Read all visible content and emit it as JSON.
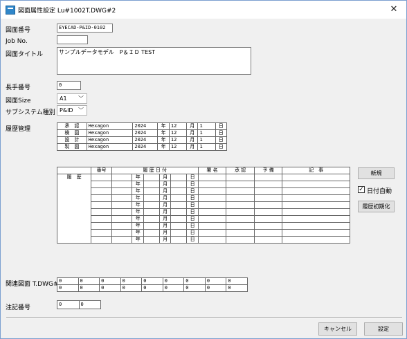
{
  "window": {
    "title": "図面属性設定 Lu#1002T.DWG#2",
    "close_icon": "close-icon"
  },
  "fields": {
    "drawing_number": {
      "label": "図面番号",
      "value": "EYECAD-P&ID-0102"
    },
    "job_no": {
      "label": "Job No.",
      "value": ""
    },
    "drawing_title": {
      "label": "図面タイトル",
      "value": "サンプルデータモデル　P＆ＩＤ TEST"
    },
    "long_number": {
      "label": "長手番号",
      "value": "0"
    },
    "drawing_size": {
      "label": "図面Size",
      "value": "A1"
    },
    "subsystem": {
      "label": "サブシステム種別",
      "value": "P&ID"
    }
  },
  "history": {
    "label": "履歴管理",
    "approvals": [
      {
        "role": "承　認",
        "name": "Hexagon",
        "year": "2024",
        "y": "年",
        "month": "12",
        "m": "月",
        "day": "1",
        "d": "日"
      },
      {
        "role": "検　図",
        "name": "Hexagon",
        "year": "2024",
        "y": "年",
        "month": "12",
        "m": "月",
        "day": "1",
        "d": "日"
      },
      {
        "role": "設　計",
        "name": "Hexagon",
        "year": "2024",
        "y": "年",
        "month": "12",
        "m": "月",
        "day": "1",
        "d": "日"
      },
      {
        "role": "製　図",
        "name": "Hexagon",
        "year": "2024",
        "y": "年",
        "month": "12",
        "m": "月",
        "day": "1",
        "d": "日"
      }
    ],
    "columns": {
      "number": "番号",
      "date": "履 歴 日 付",
      "signature": "署 名",
      "approval": "承 認",
      "spare": "予 備",
      "note": "記　事"
    },
    "row_label": "履　歴",
    "date_units": {
      "year": "年",
      "month": "月",
      "day": "日"
    },
    "rows": [
      {
        "num": "",
        "year": "",
        "month": "",
        "day": "",
        "sig": "",
        "appr": "",
        "spare": "",
        "note": ""
      },
      {
        "num": "",
        "year": "",
        "month": "",
        "day": "",
        "sig": "",
        "appr": "",
        "spare": "",
        "note": ""
      },
      {
        "num": "",
        "year": "",
        "month": "",
        "day": "",
        "sig": "",
        "appr": "",
        "spare": "",
        "note": ""
      },
      {
        "num": "",
        "year": "",
        "month": "",
        "day": "",
        "sig": "",
        "appr": "",
        "spare": "",
        "note": ""
      },
      {
        "num": "",
        "year": "",
        "month": "",
        "day": "",
        "sig": "",
        "appr": "",
        "spare": "",
        "note": ""
      },
      {
        "num": "",
        "year": "",
        "month": "",
        "day": "",
        "sig": "",
        "appr": "",
        "spare": "",
        "note": ""
      },
      {
        "num": "",
        "year": "",
        "month": "",
        "day": "",
        "sig": "",
        "appr": "",
        "spare": "",
        "note": ""
      },
      {
        "num": "",
        "year": "",
        "month": "",
        "day": "",
        "sig": "",
        "appr": "",
        "spare": "",
        "note": ""
      },
      {
        "num": "",
        "year": "",
        "month": "",
        "day": "",
        "sig": "",
        "appr": "",
        "spare": "",
        "note": ""
      },
      {
        "num": "",
        "year": "",
        "month": "",
        "day": "",
        "sig": "",
        "appr": "",
        "spare": "",
        "note": ""
      }
    ],
    "new_button": "新規",
    "auto_date_label": "日付自動",
    "auto_date_checked": true,
    "reset_button": "履歴初期化"
  },
  "related": {
    "label": "関連図面 T.DWG#",
    "row1": [
      "0",
      "0",
      "0",
      "0",
      "0",
      "0",
      "0",
      "0",
      "0"
    ],
    "row2": [
      "0",
      "0",
      "0",
      "0",
      "0",
      "0",
      "0",
      "0",
      "0"
    ]
  },
  "note_number": {
    "label": "注記番号",
    "values": [
      "0",
      "0"
    ]
  },
  "footer": {
    "cancel": "キャンセル",
    "ok": "設定"
  }
}
